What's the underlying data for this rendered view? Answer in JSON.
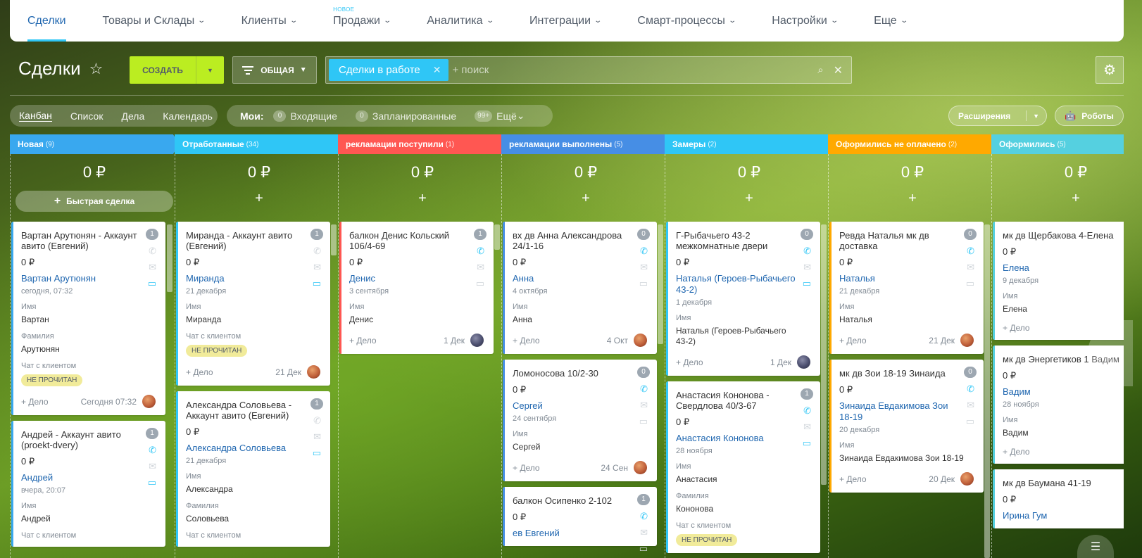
{
  "nav": {
    "items": [
      {
        "label": "Сделки",
        "active": true,
        "chevron": false,
        "badge": ""
      },
      {
        "label": "Товары и Склады",
        "active": false,
        "chevron": true,
        "badge": ""
      },
      {
        "label": "Клиенты",
        "active": false,
        "chevron": true,
        "badge": ""
      },
      {
        "label": "Продажи",
        "active": false,
        "chevron": true,
        "badge": "НОВОЕ"
      },
      {
        "label": "Аналитика",
        "active": false,
        "chevron": true,
        "badge": ""
      },
      {
        "label": "Интеграции",
        "active": false,
        "chevron": true,
        "badge": ""
      },
      {
        "label": "Смарт-процессы",
        "active": false,
        "chevron": true,
        "badge": ""
      },
      {
        "label": "Настройки",
        "active": false,
        "chevron": true,
        "badge": ""
      },
      {
        "label": "Еще",
        "active": false,
        "chevron": true,
        "badge": ""
      }
    ]
  },
  "header": {
    "title": "Сделки",
    "create_label": "СОЗДАТЬ",
    "filter_label": "ОБЩАЯ",
    "search_chip": "Сделки в работе",
    "search_placeholder": "+ поиск"
  },
  "views": {
    "items": [
      "Канбан",
      "Список",
      "Дела",
      "Календарь"
    ],
    "active": "Канбан"
  },
  "mine": {
    "title": "Мои:",
    "items": [
      {
        "count": "0",
        "label": "Входящие"
      },
      {
        "count": "0",
        "label": "Запланированные"
      },
      {
        "count": "99+",
        "label": "Ещё"
      }
    ]
  },
  "toolbar": {
    "extensions_label": "Расширения",
    "robots_label": "Роботы"
  },
  "colors": {
    "accent": "#bbed21",
    "link": "#2067b0",
    "active_nav": "#2fc6f6"
  },
  "columns": [
    {
      "title": "Новая",
      "count": "(9)",
      "color": "#39a8ef",
      "sum": "0 ₽",
      "quick_deal": "Быстрая сделка"
    },
    {
      "title": "Отработанные",
      "count": "(34)",
      "color": "#2fc6f6",
      "sum": "0 ₽",
      "quick_deal": ""
    },
    {
      "title": "рекламации поступили",
      "count": "(1)",
      "color": "#ff5752",
      "sum": "0 ₽",
      "quick_deal": ""
    },
    {
      "title": "рекламации выполнены",
      "count": "(5)",
      "color": "#468ee5",
      "sum": "0 ₽",
      "quick_deal": ""
    },
    {
      "title": "Замеры",
      "count": "(2)",
      "color": "#2fc6f6",
      "sum": "0 ₽",
      "quick_deal": ""
    },
    {
      "title": "Оформились не оплачено",
      "count": "(2)",
      "color": "#ffa900",
      "sum": "0 ₽",
      "quick_deal": ""
    },
    {
      "title": "Оформились",
      "count": "(5)",
      "color": "#55d0e0",
      "sum": "0 ₽",
      "quick_deal": ""
    }
  ],
  "cards": [
    [
      {
        "title": "Вартан Арутюнян - Аккаунт авито (Евгений)",
        "price": "0 ₽",
        "contact": "Вартан Арутюнян",
        "date": "сегодня, 07:32",
        "badge": "1",
        "fields": [
          {
            "label": "Имя",
            "value": "Вартан"
          },
          {
            "label": "Фамилия",
            "value": "Арутюнян"
          },
          {
            "label": "Чат с клиентом",
            "value": ""
          }
        ],
        "tag": "НЕ ПРОЧИТАН",
        "foot_add": "+ Дело",
        "foot_date": "Сегодня 07:32",
        "avatar": "orange",
        "chat_on": true,
        "phone_on": false
      },
      {
        "title": "Андрей - Аккаунт авито (proekt-dvery)",
        "price": "0 ₽",
        "contact": "Андрей",
        "date": "вчера, 20:07",
        "badge": "1",
        "fields": [
          {
            "label": "Имя",
            "value": "Андрей"
          },
          {
            "label": "Чат с клиентом",
            "value": ""
          }
        ],
        "tag": "",
        "foot_add": "",
        "foot_date": "",
        "avatar": "",
        "chat_on": true,
        "phone_on": true
      }
    ],
    [
      {
        "title": "Миранда - Аккаунт авито (Евгений)",
        "price": "0 ₽",
        "contact": "Миранда",
        "date": "21 декабря",
        "badge": "1",
        "fields": [
          {
            "label": "Имя",
            "value": "Миранда"
          },
          {
            "label": "Чат с клиентом",
            "value": ""
          }
        ],
        "tag": "НЕ ПРОЧИТАН",
        "foot_add": "+ Дело",
        "foot_date": "21 Дек",
        "avatar": "orange",
        "chat_on": true,
        "phone_on": false
      },
      {
        "title": "Александра Соловьева - Аккаунт авито (Евгений)",
        "price": "0 ₽",
        "contact": "Александра Соловьева",
        "date": "21 декабря",
        "badge": "1",
        "fields": [
          {
            "label": "Имя",
            "value": "Александра"
          },
          {
            "label": "Фамилия",
            "value": "Соловьева"
          },
          {
            "label": "Чат с клиентом",
            "value": ""
          }
        ],
        "tag": "",
        "foot_add": "",
        "foot_date": "",
        "avatar": "",
        "chat_on": true,
        "phone_on": false
      }
    ],
    [
      {
        "title": "балкон Денис Кольский 106/4-69",
        "price": "0 ₽",
        "contact": "Денис",
        "date": "3 сентября",
        "badge": "1",
        "fields": [
          {
            "label": "Имя",
            "value": "Денис"
          }
        ],
        "tag": "",
        "foot_add": "+ Дело",
        "foot_date": "1 Дек",
        "avatar": "dark",
        "chat_on": false,
        "phone_on": true
      }
    ],
    [
      {
        "title": "вх дв Анна Александрова 24/1-16",
        "price": "0 ₽",
        "contact": "Анна",
        "date": "4 октября",
        "badge": "0",
        "fields": [
          {
            "label": "Имя",
            "value": "Анна"
          }
        ],
        "tag": "",
        "foot_add": "+ Дело",
        "foot_date": "4 Окт",
        "avatar": "orange",
        "chat_on": false,
        "phone_on": true
      },
      {
        "title": "Ломоносова 10/2-30",
        "price": "0 ₽",
        "contact": "Сергей",
        "date": "24 сентября",
        "badge": "0",
        "fields": [
          {
            "label": "Имя",
            "value": "Сергей"
          }
        ],
        "tag": "",
        "foot_add": "+ Дело",
        "foot_date": "24 Сен",
        "avatar": "orange",
        "chat_on": false,
        "phone_on": true
      },
      {
        "title": "балкон Осипенко 2-102",
        "price": "0 ₽",
        "contact": "ев Евгений",
        "date": "",
        "badge": "1",
        "fields": [],
        "tag": "",
        "foot_add": "",
        "foot_date": "",
        "avatar": "",
        "chat_on": false,
        "phone_on": true
      }
    ],
    [
      {
        "title": "Г-Рыбачьего 43-2 межкомнатные двери",
        "price": "0 ₽",
        "contact": "Наталья (Героев-Рыбачьего 43-2)",
        "date": "1 декабря",
        "badge": "0",
        "fields": [
          {
            "label": "Имя",
            "value": "Наталья (Героев-Рыбачьего 43-2)"
          }
        ],
        "tag": "",
        "foot_add": "+ Дело",
        "foot_date": "1 Дек",
        "avatar": "dark",
        "chat_on": true,
        "phone_on": true
      },
      {
        "title": "Анастасия Кононова - Свердлова 40/3-67",
        "price": "0 ₽",
        "contact": "Анастасия Кононова",
        "date": "28 ноября",
        "badge": "1",
        "fields": [
          {
            "label": "Имя",
            "value": "Анастасия"
          },
          {
            "label": "Фамилия",
            "value": "Кононова"
          },
          {
            "label": "Чат с клиентом",
            "value": ""
          }
        ],
        "tag": "НЕ ПРОЧИТАН",
        "foot_add": "",
        "foot_date": "",
        "avatar": "",
        "chat_on": true,
        "phone_on": true
      }
    ],
    [
      {
        "title": "Ревда Наталья мк дв доставка",
        "price": "0 ₽",
        "contact": "Наталья",
        "date": "21 декабря",
        "badge": "0",
        "fields": [
          {
            "label": "Имя",
            "value": "Наталья"
          }
        ],
        "tag": "",
        "foot_add": "+ Дело",
        "foot_date": "21 Дек",
        "avatar": "orange",
        "chat_on": false,
        "phone_on": true
      },
      {
        "title": "мк дв Зои 18-19 Зинаида",
        "price": "0 ₽",
        "contact": "Зинаида Евдакимова Зои 18-19",
        "date": "20 декабря",
        "badge": "0",
        "fields": [
          {
            "label": "Имя",
            "value": "Зинаида Евдакимова Зои 18-19"
          }
        ],
        "tag": "",
        "foot_add": "+ Дело",
        "foot_date": "20 Дек",
        "avatar": "orange",
        "chat_on": false,
        "phone_on": true
      }
    ],
    [
      {
        "title": "мк дв Щербакова 4-Елена",
        "price": "0 ₽",
        "contact": "Елена",
        "date": "9 декабря",
        "badge": "",
        "fields": [
          {
            "label": "Имя",
            "value": "Елена"
          }
        ],
        "tag": "",
        "foot_add": "+ Дело",
        "foot_date": "",
        "avatar": "",
        "chat_on": false,
        "phone_on": false
      },
      {
        "title": "мк дв Энергетиков 1 Вадим",
        "price": "0 ₽",
        "contact": "Вадим",
        "date": "28 ноября",
        "badge": "",
        "fields": [
          {
            "label": "Имя",
            "value": "Вадим"
          }
        ],
        "tag": "",
        "foot_add": "+ Дело",
        "foot_date": "",
        "avatar": "",
        "chat_on": false,
        "phone_on": false
      },
      {
        "title": "мк дв Баумана 41-19",
        "price": "0 ₽",
        "contact": "Ирина Гум",
        "date": "",
        "badge": "",
        "fields": [],
        "tag": "",
        "foot_add": "",
        "foot_date": "",
        "avatar": "",
        "chat_on": false,
        "phone_on": false
      }
    ]
  ]
}
